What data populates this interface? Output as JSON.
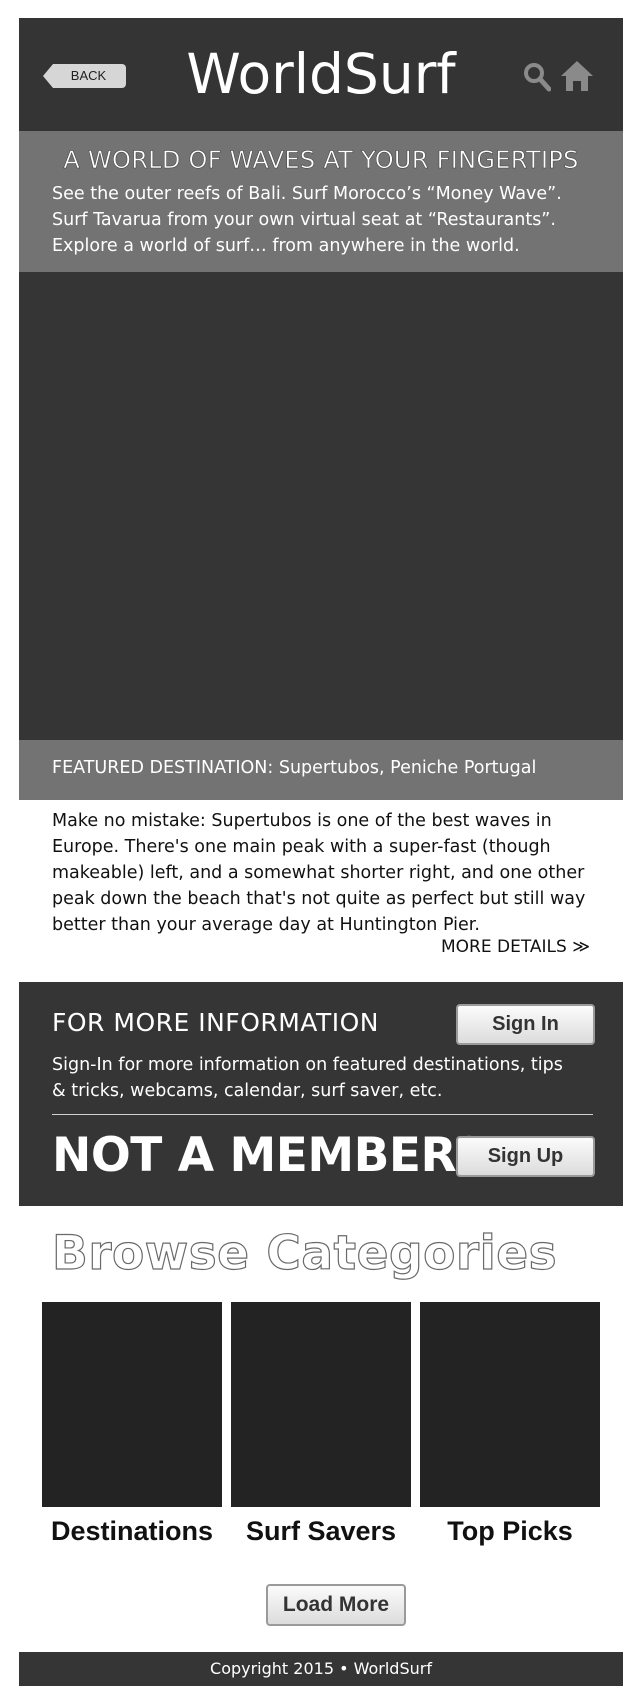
{
  "header": {
    "back_label": "BACK",
    "logo": "WorldSurf",
    "search_icon": "search-icon",
    "home_icon": "home-icon"
  },
  "hero": {
    "title": "A WORLD OF WAVES AT YOUR FINGERTIPS",
    "text": "See the outer reefs of Bali. Surf Morocco’s “Money Wave”. Surf Tavarua from your own virtual seat at “Restaurants”. Explore a world of surf… from anywhere in the world."
  },
  "featured": {
    "label": "FEATURED DESTINATION: Supertubos, Peniche Portugal",
    "body": "Make no mistake: Supertubos is one of the best waves in Europe. There's one main peak with a super-fast (though makeable) left, and a somewhat shorter right, and one other peak down the beach that's not quite as perfect but still way better than your average day at Huntington Pier.",
    "more_details": "MORE DETAILS ≫"
  },
  "info": {
    "title": "FOR MORE INFORMATION",
    "signin_label": "Sign In",
    "text": "Sign-In for more information on featured destinations, tips & tricks, webcams, calendar, surf saver, etc.",
    "not_member": "NOT A MEMBER?",
    "signup_label": "Sign Up"
  },
  "browse": {
    "title": "Browse Categories",
    "categories": [
      {
        "label": "Destinations"
      },
      {
        "label": "Surf Savers"
      },
      {
        "label": "Top Picks"
      }
    ],
    "load_more": "Load More"
  },
  "footer": {
    "copyright": "Copyright 2015 • WorldSurf"
  },
  "colors": {
    "dark_panel": "#353535",
    "mid_band": "#737373",
    "tile": "#232323"
  }
}
